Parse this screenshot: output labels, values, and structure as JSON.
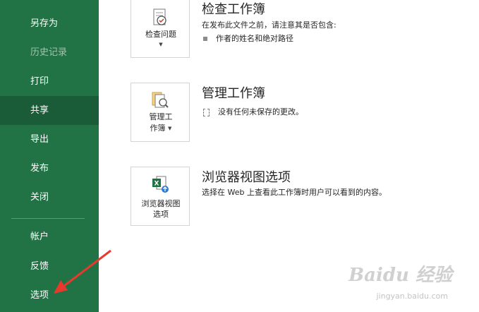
{
  "sidebar": {
    "items": [
      {
        "label": "另存为",
        "state": "normal"
      },
      {
        "label": "历史记录",
        "state": "disabled"
      },
      {
        "label": "打印",
        "state": "normal"
      },
      {
        "label": "共享",
        "state": "selected"
      },
      {
        "label": "导出",
        "state": "normal"
      },
      {
        "label": "发布",
        "state": "normal"
      },
      {
        "label": "关闭",
        "state": "normal"
      },
      {
        "label": "帐户",
        "state": "normal"
      },
      {
        "label": "反馈",
        "state": "normal"
      },
      {
        "label": "选项",
        "state": "normal"
      }
    ]
  },
  "sections": {
    "inspect": {
      "button_label": "检查问题",
      "title": "检查工作簿",
      "description": "在发布此文件之前，请注意其是否包含:",
      "bullet": "作者的姓名和绝对路径"
    },
    "manage": {
      "button_label_line1": "管理工",
      "button_label_line2": "作簿",
      "title": "管理工作簿",
      "bullet": "没有任何未保存的更改。"
    },
    "browser_view": {
      "button_label_line1": "浏览器视图",
      "button_label_line2": "选项",
      "title": "浏览器视图选项",
      "description": "选择在 Web 上查看此工作簿时用户可以看到的内容。"
    }
  },
  "watermark": {
    "text": "Baidu 经验",
    "sub": "jingyan.baidu.com"
  },
  "colors": {
    "sidebar": "#217346",
    "sidebar_selected": "#1a5c38",
    "arrow": "#e8392f"
  }
}
